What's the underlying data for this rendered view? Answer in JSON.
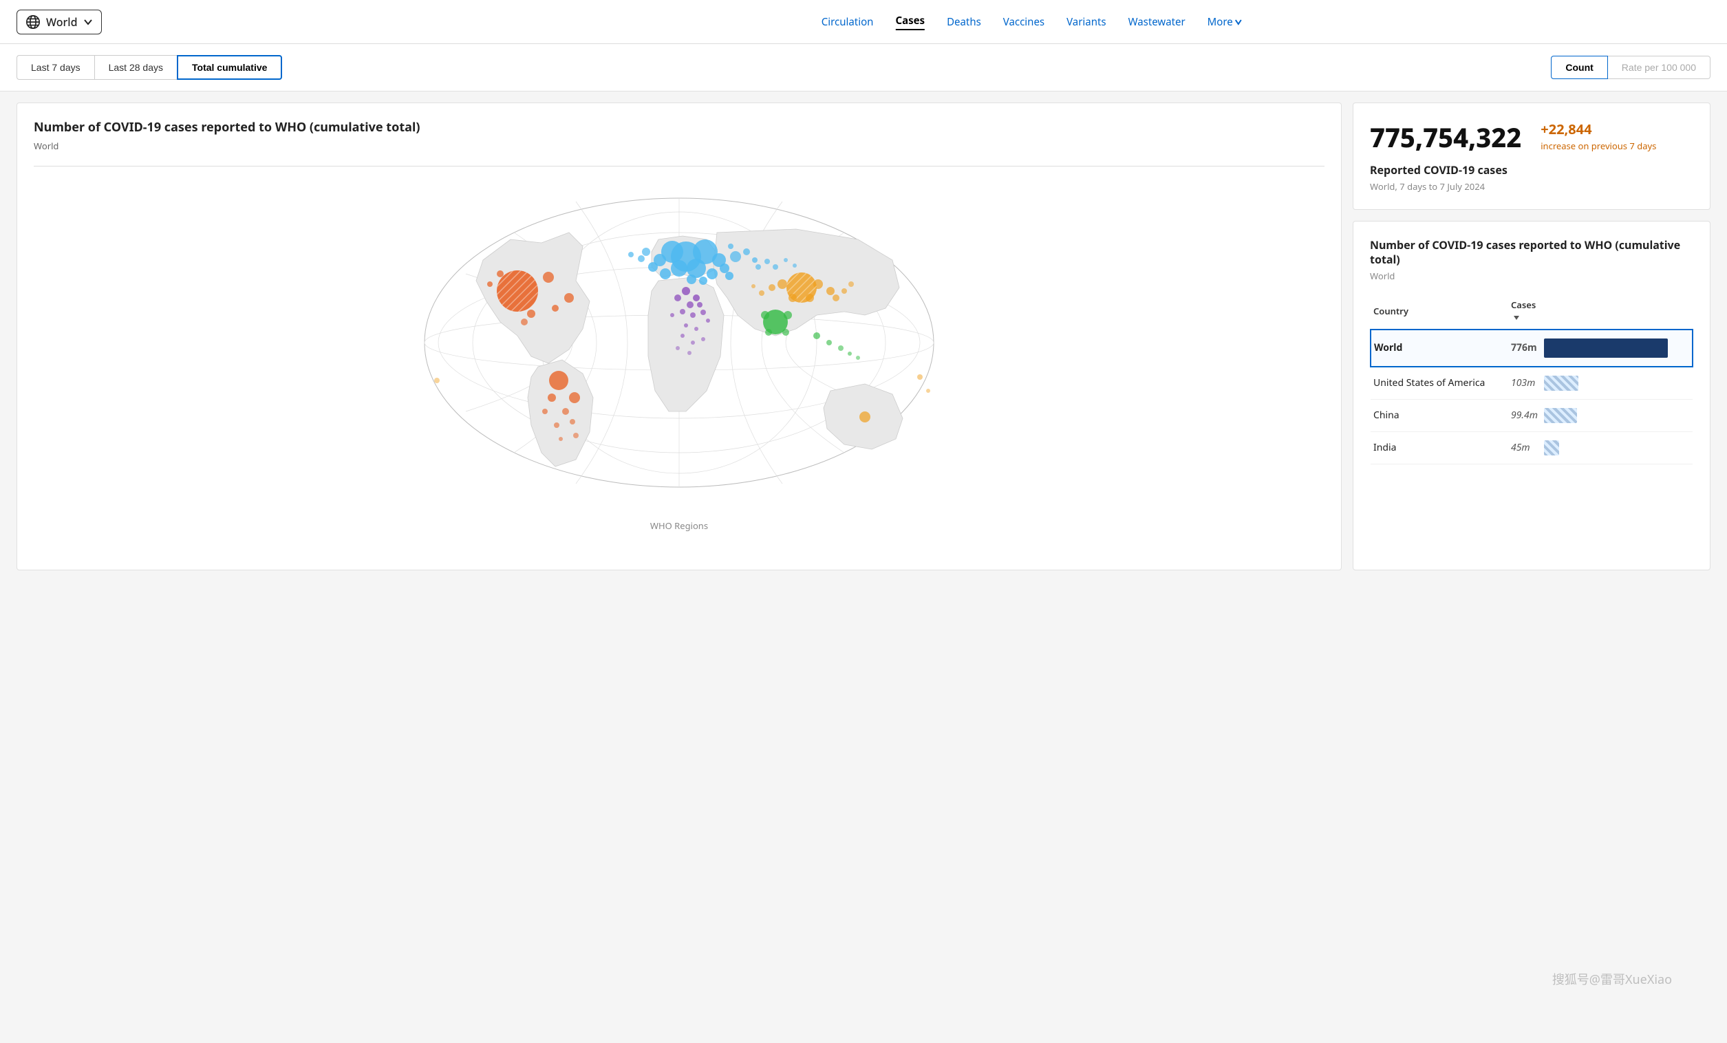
{
  "header": {
    "world_label": "World",
    "nav": {
      "circulation": "Circulation",
      "cases": "Cases",
      "deaths": "Deaths",
      "vaccines": "Vaccines",
      "variants": "Variants",
      "wastewater": "Wastewater",
      "more": "More"
    }
  },
  "filter_bar": {
    "time_tabs": [
      {
        "label": "Last 7 days",
        "active": false
      },
      {
        "label": "Last 28 days",
        "active": false
      },
      {
        "label": "Total cumulative",
        "active": true
      }
    ],
    "count_label": "Count",
    "rate_label": "Rate per 100 000"
  },
  "map_panel": {
    "title": "Number of COVID-19 cases reported to WHO (cumulative total)",
    "subtitle": "World",
    "regions_label": "WHO Regions"
  },
  "stats_card": {
    "main_number": "775,754,322",
    "increase": "+22,844",
    "increase_label": "increase on previous 7 days",
    "description": "Reported COVID-19 cases",
    "period": "World, 7 days to 7 July 2024"
  },
  "table_card": {
    "title": "Number of COVID-19 cases reported to WHO (cumulative total)",
    "subtitle": "World",
    "col_country": "Country",
    "col_cases": "Cases",
    "rows": [
      {
        "country": "World",
        "cases": "776m",
        "highlight": true
      },
      {
        "country": "United States of America",
        "cases": "103m",
        "highlight": false
      },
      {
        "country": "China",
        "cases": "99.4m",
        "highlight": false
      },
      {
        "country": "India",
        "cases": "45m",
        "highlight": false
      }
    ]
  },
  "watermark": "搜狐号@雷哥XueXiao"
}
